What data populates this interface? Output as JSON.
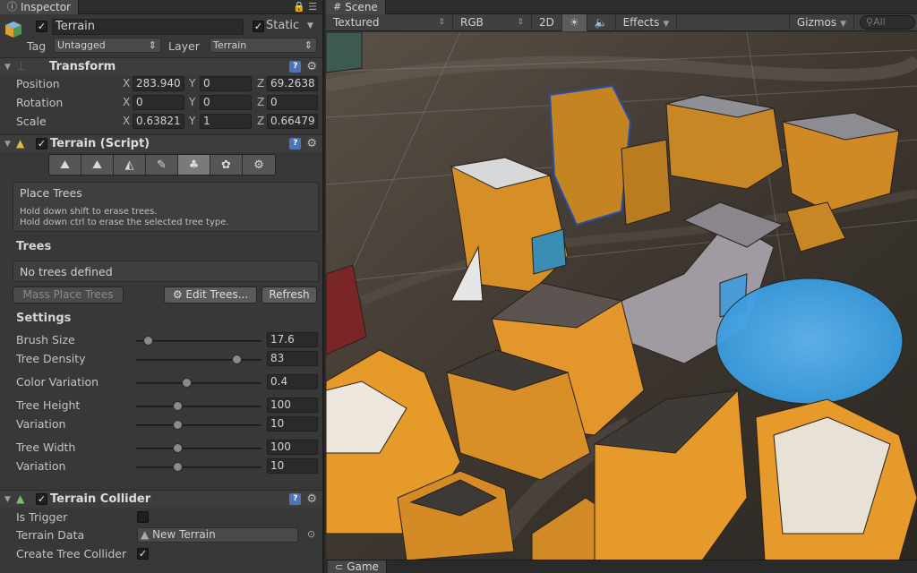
{
  "inspector": {
    "tab_label": "Inspector",
    "object": {
      "name": "Terrain",
      "active": true,
      "static_label": "Static",
      "static": true
    },
    "tag_label": "Tag",
    "tag_value": "Untagged",
    "layer_label": "Layer",
    "layer_value": "Terrain",
    "transform": {
      "title": "Transform",
      "position_label": "Position",
      "position": {
        "x": "283.940",
        "y": "0",
        "z": "69.2638"
      },
      "rotation_label": "Rotation",
      "rotation": {
        "x": "0",
        "y": "0",
        "z": "0"
      },
      "scale_label": "Scale",
      "scale": {
        "x": "0.63821",
        "y": "1",
        "z": "0.66479"
      }
    },
    "terrain_script": {
      "title": "Terrain (Script)",
      "info_title": "Place Trees",
      "info_line1": "Hold down shift to erase trees.",
      "info_line2": "Hold down ctrl to erase the selected tree type.",
      "trees_heading": "Trees",
      "no_trees": "No trees defined",
      "mass_place": "Mass Place Trees",
      "edit_trees": "Edit Trees...",
      "refresh": "Refresh",
      "settings_heading": "Settings",
      "sliders": [
        {
          "label": "Brush Size",
          "value": "17.6",
          "fraction": 0.09
        },
        {
          "label": "Tree Density",
          "value": "83",
          "fraction": 0.8
        },
        {
          "label": "Color Variation",
          "value": "0.4",
          "fraction": 0.4
        },
        {
          "label": "Tree Height",
          "value": "100",
          "fraction": 0.33
        },
        {
          "label": "Variation",
          "value": "10",
          "fraction": 0.33
        },
        {
          "label": "Tree Width",
          "value": "100",
          "fraction": 0.33
        },
        {
          "label": "Variation",
          "value": "10",
          "fraction": 0.33
        }
      ]
    },
    "collider": {
      "title": "Terrain Collider",
      "is_trigger_label": "Is Trigger",
      "is_trigger": false,
      "terrain_data_label": "Terrain Data",
      "terrain_data_value": "New Terrain",
      "create_tree_collider_label": "Create Tree Collider",
      "create_tree_collider": true
    }
  },
  "scene": {
    "tab_label": "Scene",
    "render_mode": "Textured",
    "color_mode": "RGB",
    "mode_2d": "2D",
    "effects": "Effects",
    "gizmos": "Gizmos",
    "search_placeholder": "All",
    "game_tab_label": "Game"
  },
  "colors": {
    "accent_blue": "#4d9fe0",
    "building_orange": "#e69a2a",
    "panel_bg": "#383838"
  }
}
